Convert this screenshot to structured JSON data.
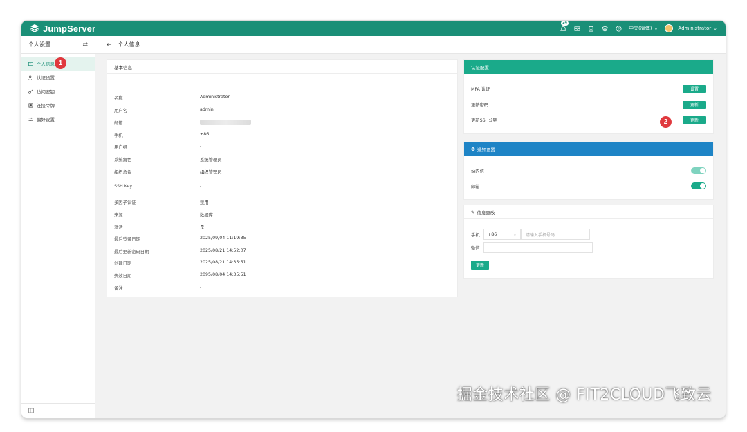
{
  "app": {
    "name": "JumpServer",
    "brand_color": "#1a8f77"
  },
  "topbar": {
    "notification_count": "24",
    "language": "中文(简体)",
    "user": "Administrator",
    "icons": [
      "bell-icon",
      "inbox-icon",
      "clipboard-icon",
      "layers-icon",
      "help-icon"
    ]
  },
  "sidebar": {
    "title": "个人设置",
    "items": [
      {
        "label": "个人信息",
        "icon": "id-card-icon",
        "active": true
      },
      {
        "label": "认证设置",
        "icon": "user-shield-icon",
        "active": false
      },
      {
        "label": "访问密钥",
        "icon": "key-icon",
        "active": false
      },
      {
        "label": "连接令牌",
        "icon": "token-icon",
        "active": false
      },
      {
        "label": "偏好设置",
        "icon": "sliders-icon",
        "active": false
      }
    ]
  },
  "breadcrumb": {
    "title": "个人信息"
  },
  "basic_info": {
    "title": "基本信息",
    "rows": [
      {
        "label": "名称",
        "value": "Administrator"
      },
      {
        "label": "用户名",
        "value": "admin"
      },
      {
        "label": "邮箱",
        "value": ""
      },
      {
        "label": "手机",
        "value": "+86"
      },
      {
        "label": "用户组",
        "value": "-"
      },
      {
        "label": "系统角色",
        "value": "系统管理员"
      },
      {
        "label": "组织角色",
        "value": "组织管理员"
      },
      {
        "label": "SSH Key",
        "value": "-"
      },
      {
        "label": "多因子认证",
        "value": "禁用"
      },
      {
        "label": "来源",
        "value": "数据库"
      },
      {
        "label": "激活",
        "value": "是"
      },
      {
        "label": "最后登录日期",
        "value": "2025/09/04 11:19:35"
      },
      {
        "label": "最后更新密码日期",
        "value": "2025/08/21 14:52:07"
      },
      {
        "label": "创建日期",
        "value": "2025/08/21 14:35:51"
      },
      {
        "label": "失效日期",
        "value": "2095/08/04 14:35:51"
      },
      {
        "label": "备注",
        "value": "-"
      }
    ]
  },
  "auth_config": {
    "title": "认证配置",
    "rows": [
      {
        "label": "MFA 认证",
        "button": "设置"
      },
      {
        "label": "更新密码",
        "button": "更新"
      },
      {
        "label": "更新SSH公钥",
        "button": "更新"
      }
    ]
  },
  "notify": {
    "title": "通知设置",
    "rows": [
      {
        "label": "站内信",
        "on": true
      },
      {
        "label": "邮箱",
        "on": true
      }
    ]
  },
  "info_change": {
    "title": "信息更改",
    "phone_label": "手机",
    "country_code": "+86",
    "phone_placeholder": "请输入手机号码",
    "wechat_label": "微信",
    "submit": "更新"
  },
  "markers": [
    "1",
    "2"
  ],
  "watermark": "掘金技术社区 @ FIT2CLOUD飞致云"
}
